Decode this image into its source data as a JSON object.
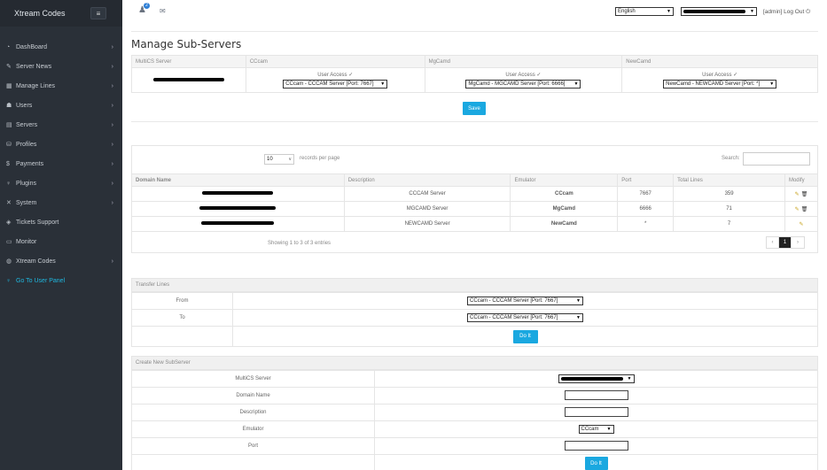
{
  "brand": {
    "name": "Xtream Codes",
    "menu_icon": "hamburger-icon"
  },
  "sidebar": {
    "items": [
      {
        "label": "DashBoard",
        "icon": "dashboard-icon",
        "glyph": "◔",
        "chev": "›"
      },
      {
        "label": "Server News",
        "icon": "pencil-icon",
        "glyph": "✎",
        "chev": "›"
      },
      {
        "label": "Manage Lines",
        "icon": "grid-icon",
        "glyph": "▦",
        "chev": "›"
      },
      {
        "label": "Users",
        "icon": "users-icon",
        "glyph": "☗",
        "chev": "›"
      },
      {
        "label": "Servers",
        "icon": "server-icon",
        "glyph": "▤",
        "chev": "›"
      },
      {
        "label": "Profiles",
        "icon": "database-icon",
        "glyph": "⛁",
        "chev": "›"
      },
      {
        "label": "Payments",
        "icon": "dollar-icon",
        "glyph": "$",
        "chev": "›"
      },
      {
        "label": "Plugins",
        "icon": "bulb-icon",
        "glyph": "♀",
        "chev": "›"
      },
      {
        "label": "System",
        "icon": "tools-icon",
        "glyph": "✕",
        "chev": "›"
      },
      {
        "label": "Tickets Support",
        "icon": "tag-icon",
        "glyph": "◈",
        "chev": ""
      },
      {
        "label": "Monitor",
        "icon": "monitor-icon",
        "glyph": "▭",
        "chev": ""
      },
      {
        "label": "Xtream Codes",
        "icon": "globe-icon",
        "glyph": "◍",
        "chev": "›"
      },
      {
        "label": "Go To User Panel",
        "icon": "bulb-icon",
        "glyph": "♀",
        "chev": ""
      }
    ]
  },
  "topbar": {
    "notifications_count": "2",
    "language": "English",
    "admin_text": "[admin] Log Out",
    "logout_glyph": "⏻"
  },
  "page_title": "Manage Sub-Servers",
  "subservers": {
    "headers": [
      "MultiCS Server",
      "CCcam",
      "MgCamd",
      "NewCamd"
    ],
    "user_access": "User Access",
    "check": "✓",
    "cccam_select": "CCcam - CCCAM Server [Port: 7667]",
    "mgcamd_select": "MgCamd - MGCAMD Server [Port: 6666]",
    "newcamd_select": "NewCamd - NEWCAMD Server [Port: *]",
    "save": "Save"
  },
  "records": {
    "per_page": "10",
    "per_page_label": "records per page",
    "search_label": "Search:",
    "columns": [
      "Domain Name",
      "Description",
      "Emulator",
      "Port",
      "Total Lines",
      "Modify"
    ],
    "rows": [
      {
        "description": "CCCAM Server",
        "emulator": "CCcam",
        "port": "7667",
        "total": "359"
      },
      {
        "description": "MGCAMD Server",
        "emulator": "MgCamd",
        "port": "6666",
        "total": "71"
      },
      {
        "description": "NEWCAMD Server",
        "emulator": "NewCamd",
        "port": "*",
        "total": "7"
      }
    ],
    "showing": "Showing 1 to 3 of 3 entries",
    "pager": [
      "‹",
      "1",
      "›"
    ]
  },
  "transfer": {
    "title": "Transfer Lines",
    "from_label": "From",
    "to_label": "To",
    "from_value": "CCcam - CCCAM Server [Port: 7667]",
    "to_value": "CCcam - CCCAM Server [Port: 7667]",
    "do_it": "Do It"
  },
  "create": {
    "title": "Create New SubServer",
    "multics_label": "MultiCS Server",
    "domain_label": "Domain Name",
    "description_label": "Description",
    "emulator_label": "Emulator",
    "emulator_value": "CCcam",
    "port_label": "Port",
    "do_it": "Do It"
  }
}
